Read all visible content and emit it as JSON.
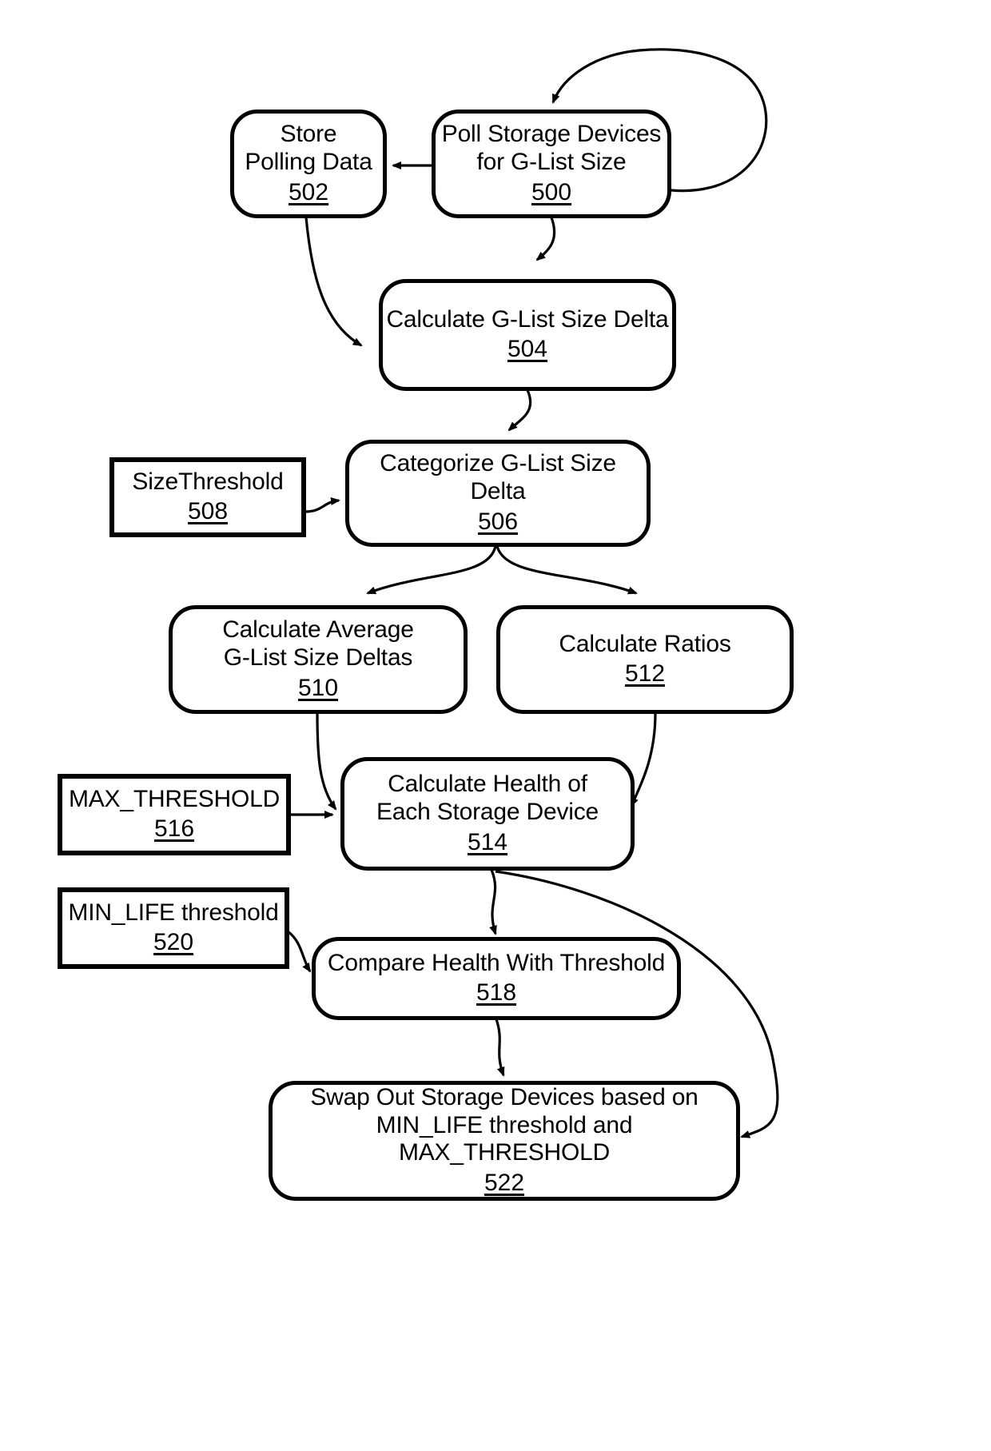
{
  "figure": {
    "type": "flowchart",
    "title": "Storage Device G-List Health Monitoring Process",
    "background_color": "#ffffff",
    "line_color": "#000000"
  },
  "nodes": [
    {
      "id": "n500",
      "ref": "500",
      "label": "Poll Storage Devices\nfor G-List Size",
      "shape": "rounded-rectangle"
    },
    {
      "id": "n502",
      "ref": "502",
      "label": "Store\nPolling Data",
      "shape": "rounded-rectangle"
    },
    {
      "id": "n504",
      "ref": "504",
      "label": "Calculate G-List Size Delta",
      "shape": "rounded-rectangle"
    },
    {
      "id": "n506",
      "ref": "506",
      "label": "Categorize G-List Size Delta",
      "shape": "rounded-rectangle"
    },
    {
      "id": "n508",
      "ref": "508",
      "label": "SizeThreshold",
      "shape": "rectangle"
    },
    {
      "id": "n510",
      "ref": "510",
      "label": "Calculate Average\nG-List Size Deltas",
      "shape": "rounded-rectangle"
    },
    {
      "id": "n512",
      "ref": "512",
      "label": "Calculate Ratios",
      "shape": "rounded-rectangle"
    },
    {
      "id": "n514",
      "ref": "514",
      "label": "Calculate Health of\nEach Storage Device",
      "shape": "rounded-rectangle"
    },
    {
      "id": "n516",
      "ref": "516",
      "label": "MAX_THRESHOLD",
      "shape": "rectangle"
    },
    {
      "id": "n518",
      "ref": "518",
      "label": "Compare Health With Threshold",
      "shape": "rounded-rectangle"
    },
    {
      "id": "n520",
      "ref": "520",
      "label": "MIN_LIFE threshold",
      "shape": "rectangle"
    },
    {
      "id": "n522",
      "ref": "522",
      "label": "Swap Out Storage Devices based on\nMIN_LIFE threshold and MAX_THRESHOLD",
      "shape": "rounded-rectangle"
    }
  ],
  "edges": [
    {
      "from": "500",
      "to": "500",
      "kind": "self-loop"
    },
    {
      "from": "500",
      "to": "502",
      "kind": "straight"
    },
    {
      "from": "500",
      "to": "504",
      "kind": "curved"
    },
    {
      "from": "502",
      "to": "504",
      "kind": "curved"
    },
    {
      "from": "504",
      "to": "506",
      "kind": "curved"
    },
    {
      "from": "508",
      "to": "506",
      "kind": "curved"
    },
    {
      "from": "506",
      "to": "510",
      "kind": "curved-branch"
    },
    {
      "from": "506",
      "to": "512",
      "kind": "curved-branch"
    },
    {
      "from": "510",
      "to": "514",
      "kind": "curved"
    },
    {
      "from": "512",
      "to": "514",
      "kind": "curved"
    },
    {
      "from": "516",
      "to": "514",
      "kind": "straight"
    },
    {
      "from": "514",
      "to": "518",
      "kind": "curved"
    },
    {
      "from": "520",
      "to": "518",
      "kind": "curved"
    },
    {
      "from": "514",
      "to": "522",
      "kind": "curved-long"
    },
    {
      "from": "518",
      "to": "522",
      "kind": "curved"
    }
  ]
}
